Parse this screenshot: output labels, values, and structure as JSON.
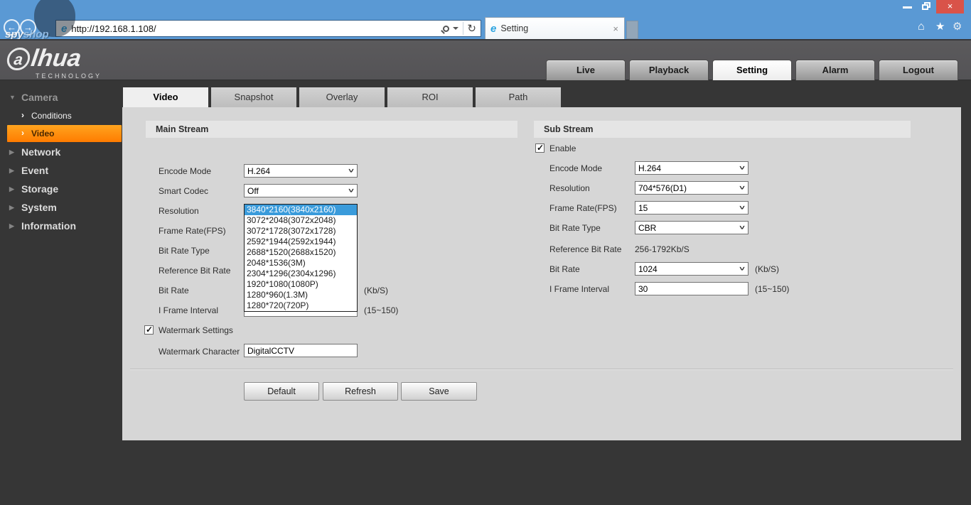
{
  "browser": {
    "url": "http://192.168.1.108/",
    "tab_title": "Setting",
    "watermark_spy": "spy",
    "watermark_shop": "shop"
  },
  "header": {
    "logo_first": "a",
    "logo_rest": "lhua",
    "logo_sub": "TECHNOLOGY",
    "nav": [
      {
        "label": "Live",
        "active": false
      },
      {
        "label": "Playback",
        "active": false
      },
      {
        "label": "Setting",
        "active": true
      },
      {
        "label": "Alarm",
        "active": false
      },
      {
        "label": "Logout",
        "active": false
      }
    ]
  },
  "sidebar": {
    "items": [
      {
        "label": "Camera",
        "state": "expanded"
      },
      {
        "label": "Conditions"
      },
      {
        "label": "Video",
        "active": true
      },
      {
        "label": "Network"
      },
      {
        "label": "Event"
      },
      {
        "label": "Storage"
      },
      {
        "label": "System"
      },
      {
        "label": "Information"
      }
    ]
  },
  "tabs": [
    {
      "label": "Video",
      "active": true
    },
    {
      "label": "Snapshot",
      "active": false
    },
    {
      "label": "Overlay",
      "active": false
    },
    {
      "label": "ROI",
      "active": false
    },
    {
      "label": "Path",
      "active": false
    }
  ],
  "main_stream": {
    "title": "Main Stream",
    "rows": [
      {
        "label": "Encode Mode",
        "value": "H.264",
        "type": "select"
      },
      {
        "label": "Smart Codec",
        "value": "Off",
        "type": "select"
      },
      {
        "label": "Resolution",
        "value": "3840*2160(3840x2160)",
        "type": "select-open"
      },
      {
        "label": "Frame Rate(FPS)",
        "value": "",
        "type": "select"
      },
      {
        "label": "Bit Rate Type",
        "value": "",
        "type": "select"
      },
      {
        "label": "Reference Bit Rate",
        "value": "",
        "type": "text"
      },
      {
        "label": "Bit Rate",
        "value": "",
        "type": "select",
        "unit": "(Kb/S)"
      },
      {
        "label": "I Frame Interval",
        "value": "",
        "type": "input",
        "unit": "(15~150)"
      }
    ],
    "watermark_settings": {
      "label": "Watermark Settings",
      "checked": true
    },
    "watermark_character": {
      "label": "Watermark Character",
      "value": "DigitalCCTV"
    }
  },
  "resolution_dropdown": {
    "selected_index": 0,
    "options": [
      "3840*2160(3840x2160)",
      "3072*2048(3072x2048)",
      "3072*1728(3072x1728)",
      "2592*1944(2592x1944)",
      "2688*1520(2688x1520)",
      "2048*1536(3M)",
      "2304*1296(2304x1296)",
      "1920*1080(1080P)",
      "1280*960(1.3M)",
      "1280*720(720P)"
    ]
  },
  "sub_stream": {
    "title": "Sub Stream",
    "enable": {
      "label": "Enable",
      "checked": true
    },
    "rows": [
      {
        "label": "Encode Mode",
        "value": "H.264",
        "type": "select"
      },
      {
        "label": "Resolution",
        "value": "704*576(D1)",
        "type": "select"
      },
      {
        "label": "Frame Rate(FPS)",
        "value": "15",
        "type": "select"
      },
      {
        "label": "Bit Rate Type",
        "value": "CBR",
        "type": "select"
      },
      {
        "label": "Reference Bit Rate",
        "value": "256-1792Kb/S",
        "type": "text"
      },
      {
        "label": "Bit Rate",
        "value": "1024",
        "type": "select",
        "unit": "(Kb/S)"
      },
      {
        "label": "I Frame Interval",
        "value": "30",
        "type": "input",
        "unit": "(15~150)"
      }
    ]
  },
  "actions": [
    {
      "label": "Default"
    },
    {
      "label": "Refresh"
    },
    {
      "label": "Save"
    }
  ],
  "colors": {
    "chrome_blue": "#5a99d4",
    "accent_orange": "#ff8a00",
    "selection_blue": "#3a9bdb",
    "panel_gray": "#d6d6d6",
    "dark_bg": "#363636",
    "close_red": "#d95349"
  }
}
